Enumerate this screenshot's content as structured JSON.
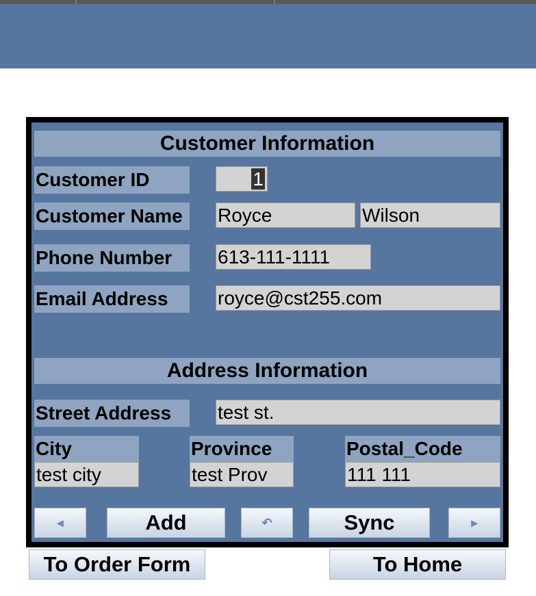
{
  "customer": {
    "section_title": "Customer Information",
    "id_label": "Customer ID",
    "id_value": "1",
    "name_label": "Customer Name",
    "first_name": "Royce",
    "last_name": "Wilson",
    "phone_label": "Phone Number",
    "phone_value": "613-111-1111",
    "email_label": "Email Address",
    "email_value": "royce@cst255.com"
  },
  "address": {
    "section_title": "Address Information",
    "street_label": "Street Address",
    "street_value": "test st.",
    "city_label": "City",
    "city_value": "test city",
    "province_label": "Province",
    "province_value": "test Prov",
    "postal_label": "Postal_Code",
    "postal_value": "111 111"
  },
  "nav": {
    "prev_icon": "◂",
    "add_label": "Add",
    "undo_icon": "↶",
    "sync_label": "Sync",
    "next_icon": "▸",
    "to_order_label": "To Order Form",
    "to_home_label": "To Home"
  },
  "colors": {
    "panel_bg": "#56769f",
    "label_bg": "#8ea4c0",
    "field_bg": "#d3d3d3",
    "frame": "#000000"
  }
}
